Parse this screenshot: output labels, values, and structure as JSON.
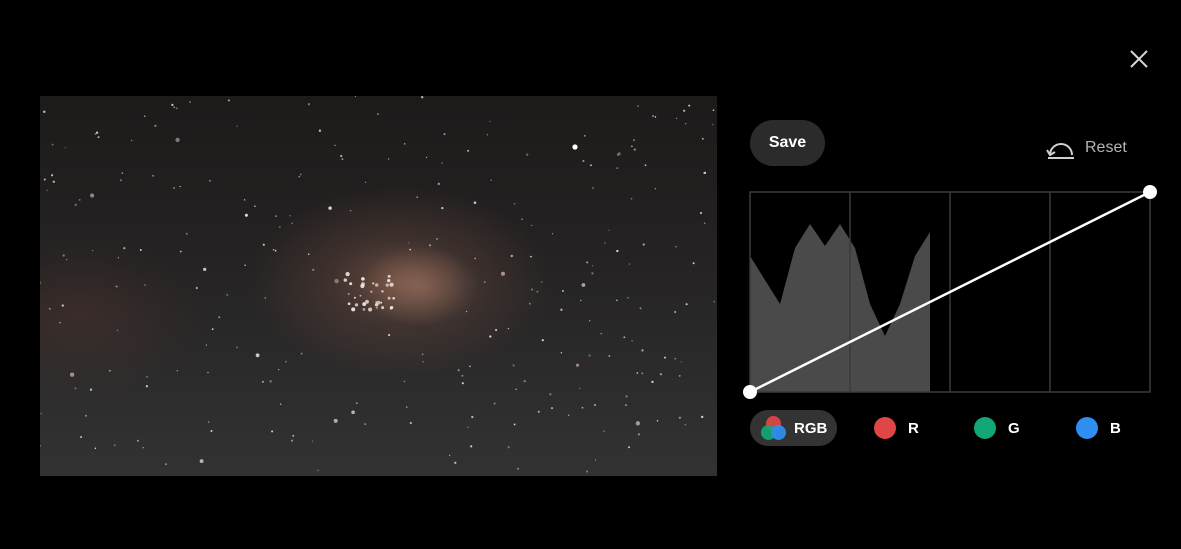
{
  "toolbar": {
    "save_label": "Save",
    "reset_label": "Reset"
  },
  "icons": {
    "close": "close-icon",
    "reset": "reset-arrow-icon",
    "rgb": "rgb-circles-icon"
  },
  "channels": [
    {
      "label": "RGB",
      "color": "#ffffff",
      "active": true
    },
    {
      "label": "R",
      "color": "#e04646",
      "active": false
    },
    {
      "label": "G",
      "color": "#12a777",
      "active": false
    },
    {
      "label": "B",
      "color": "#2e8ff0",
      "active": false
    }
  ],
  "colors": {
    "background": "#000000",
    "button_bg": "#2b2b2b",
    "histogram_fill": "#4a4a4a",
    "grid_line": "#3a3a3a",
    "curve": "#ffffff"
  },
  "curve": {
    "points": [
      {
        "input": 0.0,
        "output": 0.0
      },
      {
        "input": 1.0,
        "output": 1.0
      }
    ]
  },
  "histogram": {
    "values": [
      0.68,
      0.56,
      0.44,
      0.72,
      0.84,
      0.73,
      0.84,
      0.72,
      0.44,
      0.28,
      0.44,
      0.68,
      0.8
    ],
    "extent": 0.45
  }
}
